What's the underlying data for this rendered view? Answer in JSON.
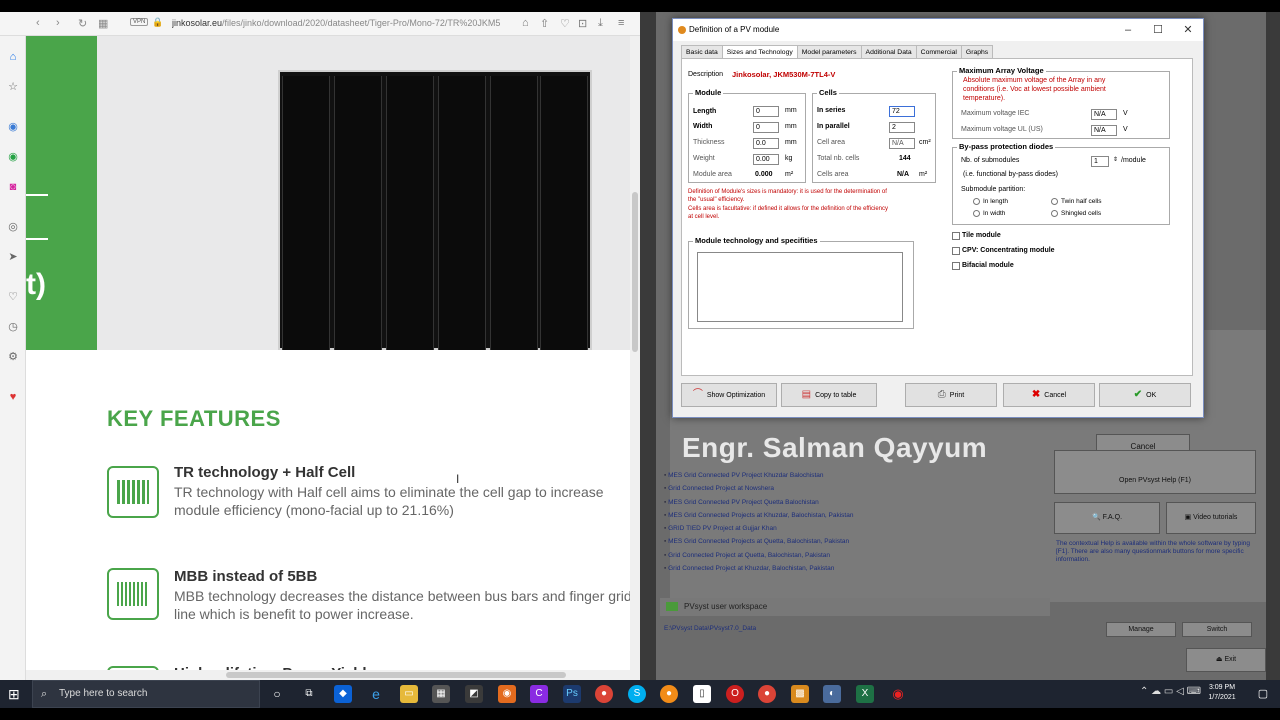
{
  "browser": {
    "url_domain": "jinkosolar.eu",
    "url_path": "/files/jinko/download/2020/datasheet/Tiger-Pro/Mono-72/TR%20JKM5",
    "vpn_label": "VPN",
    "hero_text": "t)",
    "key_features_title": "KEY FEATURES",
    "features": [
      {
        "title": "TR technology + Half Cell",
        "desc": "TR technology with Half cell aims to eliminate the cell gap to increase module efficiency (mono-facial up to 21.16%)"
      },
      {
        "title": "MBB instead of 5BB",
        "desc": "MBB technology decreases the distance between bus bars and finger grid line which is benefit to power increase."
      },
      {
        "title": "Higher lifetime Power Yield",
        "desc": ""
      }
    ]
  },
  "dialog": {
    "title": "Definition of a PV module",
    "tabs": [
      "Basic data",
      "Sizes and Technology",
      "Model parameters",
      "Additional Data",
      "Commercial",
      "Graphs"
    ],
    "description_label": "Description",
    "description_value": "Jinkosolar,  JKM530M-7TL4-V",
    "module_group": "Module",
    "length_label": "Length",
    "length_value": "0",
    "length_unit": "mm",
    "width_label": "Width",
    "width_value": "0",
    "width_unit": "mm",
    "thickness_label": "Thickness",
    "thickness_value": "0.0",
    "thickness_unit": "mm",
    "weight_label": "Weight",
    "weight_value": "0.00",
    "weight_unit": "kg",
    "module_area_label": "Module area",
    "module_area_value": "0.000",
    "module_area_unit": "m²",
    "cells_group": "Cells",
    "in_series_label": "In series",
    "in_series_value": "72",
    "in_parallel_label": "In parallel",
    "in_parallel_value": "2",
    "cell_area_label": "Cell area",
    "cell_area_value": "N/A",
    "cell_area_unit": "cm²",
    "total_cells_label": "Total nb. cells",
    "total_cells_value": "144",
    "cells_area_label": "Cells area",
    "cells_area_value": "N/A",
    "cells_area_unit": "m²",
    "note_1": "Definition of Module's sizes is mandatory: it is used for the determination of",
    "note_2": "the \"usual\" efficiency.",
    "note_3": "Cells area is facultative: if defined it allows for the definition of the efficiency",
    "note_4": "at cell level.",
    "tech_group": "Module technology and specifities",
    "max_voltage_group": "Maximum Array Voltage",
    "max_voltage_note_1": "Absolute maximum voltage of the Array in any",
    "max_voltage_note_2": "conditions (i.e. Voc at lowest possible ambient",
    "max_voltage_note_3": "temperature).",
    "max_iec_label": "Maximum voltage IEC",
    "max_iec_value": "N/A",
    "max_iec_unit": "V",
    "max_ul_label": "Maximum voltage UL (US)",
    "max_ul_value": "N/A",
    "max_ul_unit": "V",
    "bypass_group": "By-pass protection diodes",
    "submodules_label": "Nb. of submodules",
    "submodules_value": "1",
    "submodules_unit": "/module",
    "submodules_note": "(i.e. functional by-pass diodes)",
    "partition_label": "Submodule partition:",
    "partition_options": [
      "In length",
      "Twin half cells",
      "In width",
      "Shingled cells"
    ],
    "tile_label": "Tile module",
    "cpv_label": "CPV: Concentrating module",
    "bifacial_label": "Bifacial module",
    "btn_optimization": "Show Optimization",
    "btn_copy": "Copy to table",
    "btn_print": "Print",
    "btn_cancel": "Cancel",
    "btn_ok": "OK"
  },
  "pvsyst": {
    "watermark": "Engr. Salman Qayyum",
    "cancel_label": "Cancel",
    "projects": [
      "MES Grid Connected PV Project Khuzdar Balochistan",
      "Grid Connected Project at Nowshera",
      "MES Grid Connected PV Project Quetta Balochistan",
      "MES Grid Connected Projects at Khuzdar, Balochistan, Pakistan",
      "GRID TIED PV Project at Gujjar Khan",
      "MES Grid Connected Projects at Quetta, Balochistan, Pakistan",
      "Grid Connected Project at Quetta, Balochistan, Pakistan",
      "Grid Connected Project at Khuzdar, Balochistan, Pakistan"
    ],
    "open_help": "Open PVsyst Help (F1)",
    "faq": "F.A.Q.",
    "video_tutorials": "Video tutorials",
    "help_text": "The contextual Help is available within the whole software by typing [F1]. There are also many questionmark buttons for more specific information.",
    "workspace_label": "PVsyst user workspace",
    "workspace_path": "E:\\PVsyst Data\\PVsyst7.0_Data",
    "manage": "Manage",
    "switch": "Switch",
    "exit": "Exit"
  },
  "taskbar": {
    "search_placeholder": "Type here to search",
    "time": "3:09 PM",
    "date": "1/7/2021"
  },
  "colors": {
    "accent_green": "#4aa54a",
    "dialog_red": "#c00000"
  }
}
